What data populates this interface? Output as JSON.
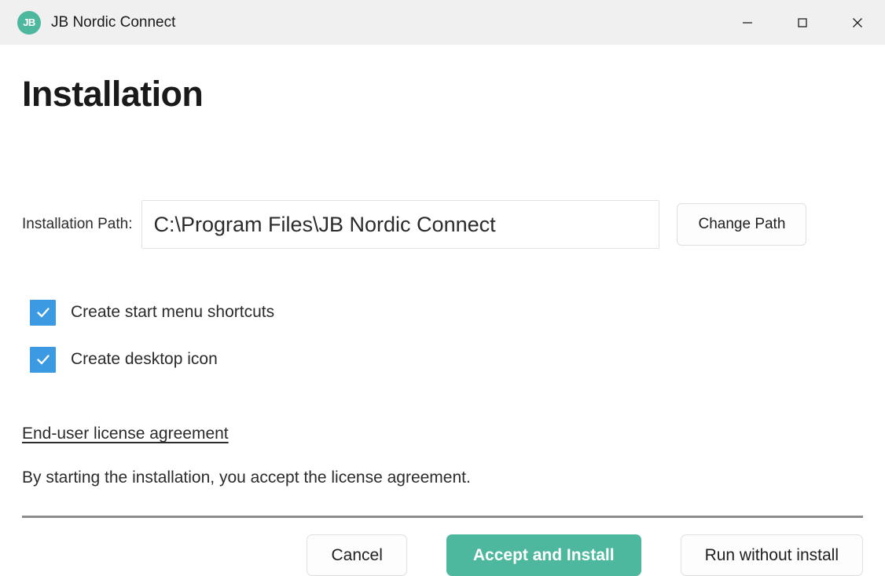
{
  "window": {
    "title": "JB Nordic Connect",
    "logo_text": "JB",
    "logo_color": "#4eb89f",
    "controls": {
      "minimize": "minimize-icon",
      "maximize": "maximize-icon",
      "close": "close-icon"
    }
  },
  "page": {
    "heading": "Installation"
  },
  "path": {
    "label": "Installation Path:",
    "value": "C:\\Program Files\\JB Nordic Connect",
    "placeholder": "C:\\Program Files\\JB Nordic Connect",
    "change_button": "Change Path"
  },
  "options": [
    {
      "label": "Create start menu shortcuts",
      "checked": true
    },
    {
      "label": "Create desktop icon",
      "checked": true
    }
  ],
  "license": {
    "link": "End-user license agreement",
    "note": "By starting the installation, you accept the license agreement."
  },
  "footer": {
    "cancel": "Cancel",
    "accept": "Accept and Install",
    "run_without_install": "Run without install"
  },
  "colors": {
    "accent": "#4eb89f",
    "checkbox": "#3b9ae1",
    "titlebar": "#f0f0f0",
    "divider": "#8d8d8d"
  }
}
